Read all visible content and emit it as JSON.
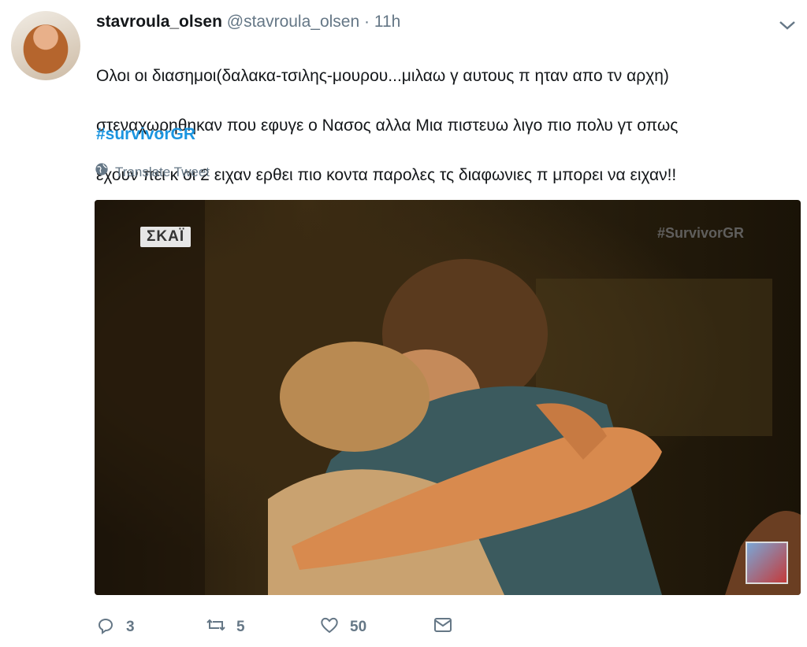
{
  "tweet": {
    "author_name": "stavroula_olsen",
    "author_handle": "@stavroula_olsen",
    "separator": "·",
    "time": "11h",
    "text_lines": [
      "Ολοι οι διασημοι(δαλακα-τσιλης-μουρου...μιλαω γ αυτους π ηταν απο τν αρχη)",
      "στεναχωρηθηκαν που εφυγε ο Νασος αλλα Μια πιστευω λιγο πιο πολυ γτ οπως",
      "εχουν πει κ οι 2 ειχαν ερθει πιο κοντα παρολες τς διαφωνιες π μπορει να ειχαν!!"
    ],
    "hashtag": "#survivorGR",
    "translate_label": "Translate Tweet"
  },
  "media": {
    "channel_logo": "ΣΚΑΪ",
    "overlay_tag": "#SurvivorGR"
  },
  "actions": {
    "replies": "3",
    "retweets": "5",
    "likes": "50"
  },
  "colors": {
    "hashtag": "#1b95e0",
    "muted": "#657786",
    "text": "#14171a"
  },
  "icons": [
    "chevron-down-icon",
    "globe-icon",
    "reply-icon",
    "retweet-icon",
    "like-icon",
    "message-icon"
  ]
}
